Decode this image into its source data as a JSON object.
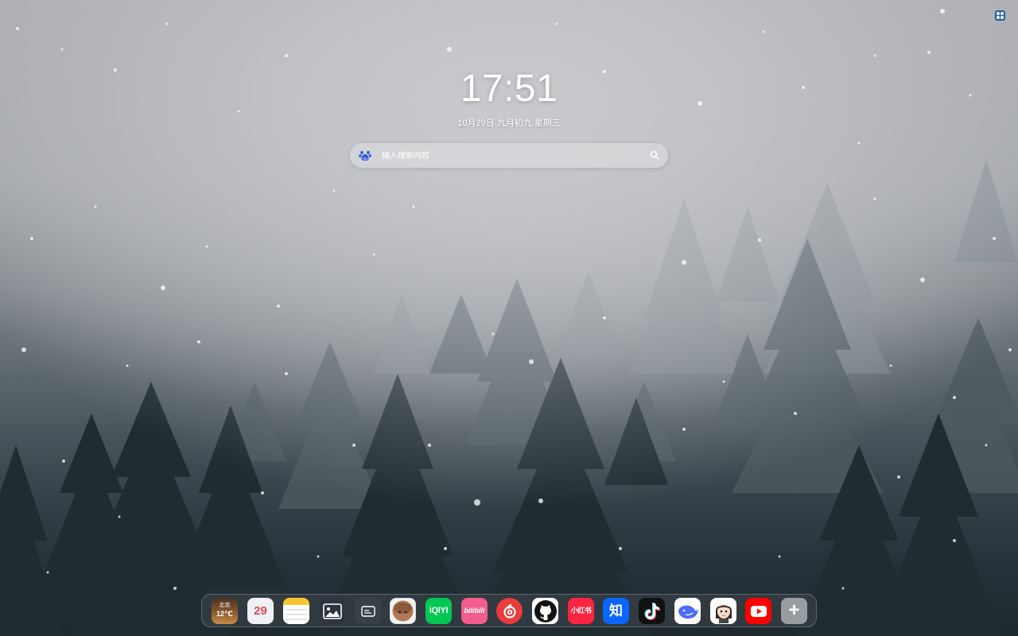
{
  "clock": {
    "time": "17:51",
    "date": "10月29日 九月初九 星期三"
  },
  "search": {
    "placeholder": "输入搜索内容",
    "value": "",
    "engine_icon": "baidu-paw-icon",
    "button_icon": "search-icon"
  },
  "corner_widget": {
    "icon": "apps-grid-icon",
    "color": "#1f5f9e"
  },
  "dock": {
    "items": [
      {
        "name": "weather",
        "city": "北京",
        "temp": "12℃",
        "bg": "#6b4a2e"
      },
      {
        "name": "calendar",
        "label": "29",
        "bg": "#eef1f6"
      },
      {
        "name": "notes",
        "icon": "notes-icon",
        "bg": "#ffffff"
      },
      {
        "name": "photos",
        "icon": "image-icon",
        "bg": "#2e3440"
      },
      {
        "name": "cards",
        "icon": "card-icon",
        "bg": "#3a3f4a"
      },
      {
        "name": "avatar",
        "icon": "avatar-icon",
        "bg": "#f2f2f2"
      },
      {
        "name": "iqiyi",
        "label": "iQIYI",
        "bg": "#00c853"
      },
      {
        "name": "bilibili",
        "label": "bilibili",
        "bg": "#f25d8e"
      },
      {
        "name": "netease-music",
        "icon": "netease-music-icon",
        "bg": "#ea3c3c"
      },
      {
        "name": "github",
        "icon": "github-icon",
        "bg": "#ffffff"
      },
      {
        "name": "xiaohongshu",
        "label": "小红书",
        "bg": "#ff2442"
      },
      {
        "name": "zhihu",
        "label": "知",
        "bg": "#0a66ff"
      },
      {
        "name": "douyin",
        "icon": "tiktok-icon",
        "bg": "#111111"
      },
      {
        "name": "deepseek",
        "icon": "deepseek-whale-icon",
        "bg": "#ffffff"
      },
      {
        "name": "character",
        "icon": "character-icon",
        "bg": "#ffffff"
      },
      {
        "name": "youtube",
        "icon": "youtube-icon",
        "bg": "#ff0000"
      },
      {
        "name": "add",
        "label": "+",
        "bg": "#9a9d9f"
      }
    ]
  }
}
